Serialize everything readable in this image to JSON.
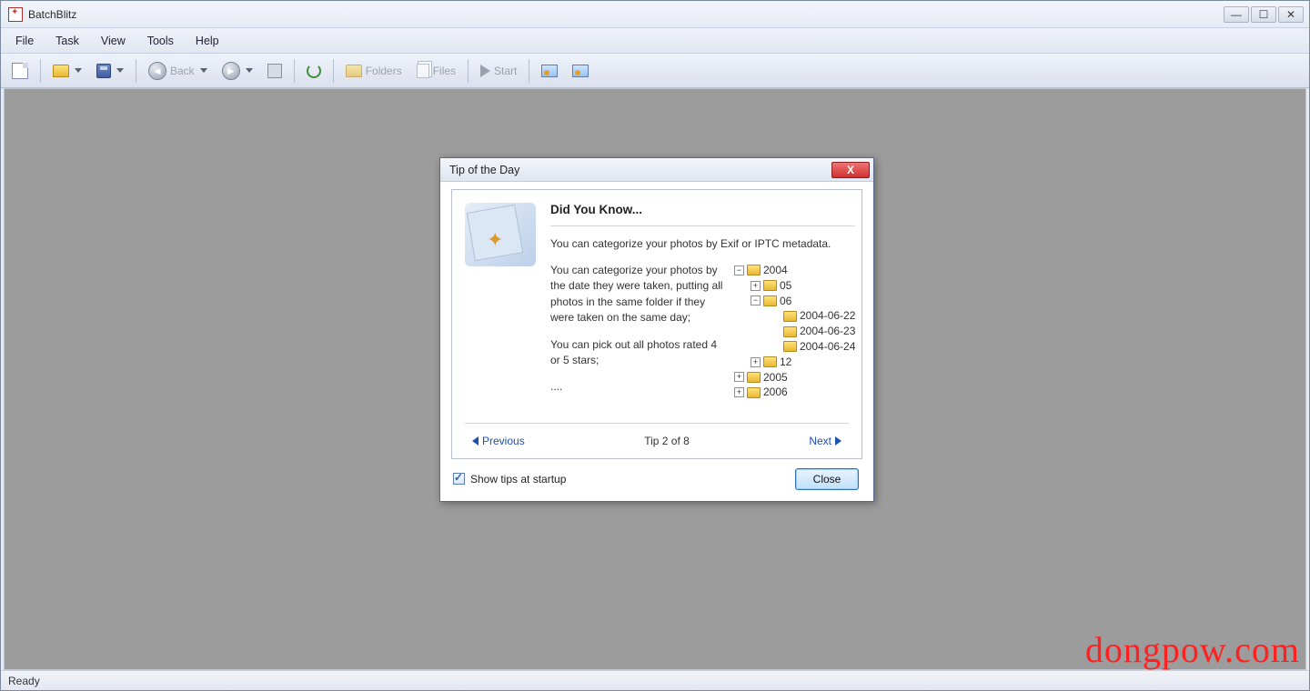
{
  "app": {
    "title": "BatchBlitz"
  },
  "menus": {
    "file": "File",
    "task": "Task",
    "view": "View",
    "tools": "Tools",
    "help": "Help"
  },
  "toolbar": {
    "back": "Back",
    "folders": "Folders",
    "files": "Files",
    "start": "Start"
  },
  "dialog": {
    "title": "Tip of the Day",
    "heading": "Did You Know...",
    "summary": "You can categorize your photos by Exif or IPTC metadata.",
    "para1": "You can categorize your photos by the date they were taken, putting all photos in the same folder if they were taken on the same day;",
    "para2": "You can pick out all photos rated 4 or 5 stars;",
    "para3": "....",
    "prev": "Previous",
    "counter": "Tip 2 of 8",
    "next": "Next",
    "show_tips": "Show tips at startup",
    "close": "Close",
    "tree": {
      "y2004": "2004",
      "m05": "05",
      "m06": "06",
      "d1": "2004-06-22",
      "d2": "2004-06-23",
      "d3": "2004-06-24",
      "m12": "12",
      "y2005": "2005",
      "y2006": "2006"
    }
  },
  "status": {
    "text": "Ready"
  },
  "watermark": "dongpow.com"
}
